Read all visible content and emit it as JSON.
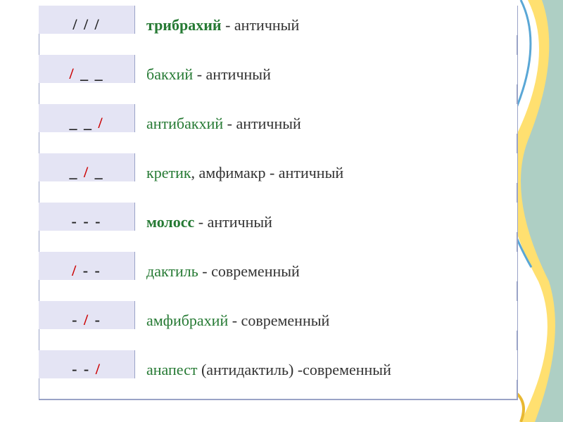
{
  "chart_data": {
    "type": "table",
    "title": "",
    "columns": [
      "pattern",
      "name",
      "category"
    ],
    "rows": [
      {
        "pattern": "/ / /",
        "name": "трибрахий",
        "category": "античный"
      },
      {
        "pattern": "/ _ _",
        "name": "бакхий",
        "category": "античный"
      },
      {
        "pattern": "_ _ /",
        "name": "антибакхий",
        "category": "античный"
      },
      {
        "pattern": "_ / _",
        "name": "кретик, амфимакр",
        "category": "античный"
      },
      {
        "pattern": "- - -",
        "name": "молосс",
        "category": "античный"
      },
      {
        "pattern": "/ - -",
        "name": "дактиль",
        "category": "современный"
      },
      {
        "pattern": "- / -",
        "name": "амфибрахий",
        "category": "современный"
      },
      {
        "pattern": "- - /",
        "name": "анапест (антидактиль)",
        "category": "современный"
      }
    ]
  },
  "rows": [
    {
      "sym_parts": [
        {
          "txt": "/ / /",
          "cls": "blk"
        }
      ],
      "name": "трибрахий",
      "name_bold": true,
      "extra": "",
      "tail": " - античный"
    },
    {
      "sym_parts": [
        {
          "txt": "/",
          "cls": "red"
        },
        {
          "txt": " _ _",
          "cls": "blk"
        }
      ],
      "name": "бакхий",
      "name_bold": false,
      "extra": "",
      "tail": " - античный"
    },
    {
      "sym_parts": [
        {
          "txt": "_ _  ",
          "cls": "blk"
        },
        {
          "txt": "/",
          "cls": "red"
        }
      ],
      "name": "антибакхий",
      "name_bold": false,
      "extra": "",
      "tail": " - античный"
    },
    {
      "sym_parts": [
        {
          "txt": "_  ",
          "cls": "blk"
        },
        {
          "txt": "/",
          "cls": "red"
        },
        {
          "txt": "  _",
          "cls": "blk"
        }
      ],
      "name": "кретик",
      "name_bold": false,
      "extra": ", амфимакр",
      "tail": " - античный"
    },
    {
      "sym_parts": [
        {
          "txt": "-  -  -",
          "cls": "blk"
        }
      ],
      "name": "молосс",
      "name_bold": true,
      "extra": "",
      "tail": " - античный"
    },
    {
      "sym_parts": [
        {
          "txt": "/",
          "cls": "red"
        },
        {
          "txt": " - -",
          "cls": "blk"
        }
      ],
      "name": "дактиль",
      "name_bold": false,
      "extra": "",
      "tail": " - современный"
    },
    {
      "sym_parts": [
        {
          "txt": "-  ",
          "cls": "blk"
        },
        {
          "txt": "/",
          "cls": "red"
        },
        {
          "txt": "  -",
          "cls": "blk"
        }
      ],
      "name": "амфибрахий",
      "name_bold": false,
      "extra": "",
      "tail": " - современный"
    },
    {
      "sym_parts": [
        {
          "txt": "-  -  ",
          "cls": "blk"
        },
        {
          "txt": "/",
          "cls": "red"
        }
      ],
      "name": "анапест",
      "name_bold": false,
      "extra": " (антидактиль)",
      "tail": " -современный"
    }
  ]
}
